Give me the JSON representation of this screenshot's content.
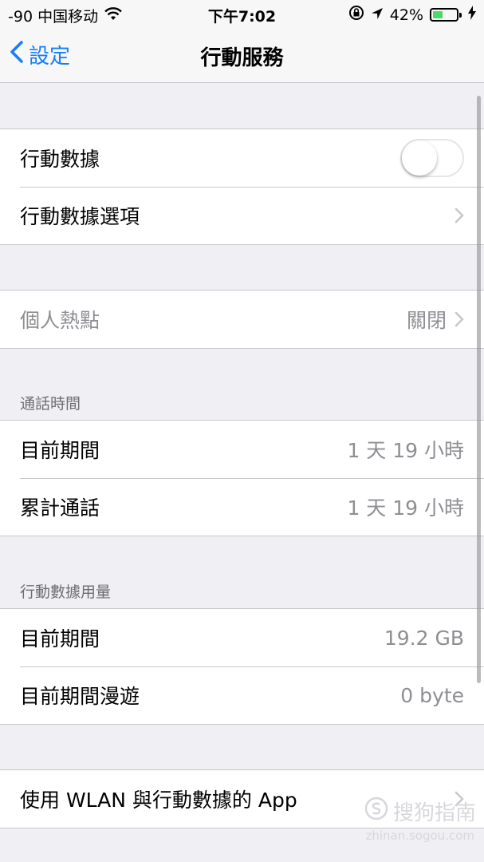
{
  "status_bar": {
    "carrier": "-90 中国移动",
    "time": "下午7:02",
    "battery_percent": "42%",
    "battery_level": 0.42,
    "icons": [
      "wifi-icon",
      "rotation-lock-icon",
      "location-arrow-icon",
      "battery-icon",
      "charging-bolt-icon"
    ]
  },
  "nav": {
    "back_label": "設定",
    "title": "行動服務"
  },
  "section1": {
    "rows": [
      {
        "label": "行動數據",
        "toggle_on": false
      },
      {
        "label": "行動數據選項"
      }
    ]
  },
  "section2": {
    "rows": [
      {
        "label": "個人熱點",
        "value": "關閉"
      }
    ]
  },
  "section3": {
    "header": "通話時間",
    "rows": [
      {
        "label": "目前期間",
        "value": "1 天 19 小時"
      },
      {
        "label": "累計通話",
        "value": "1 天 19 小時"
      }
    ]
  },
  "section4": {
    "header": "行動數據用量",
    "rows": [
      {
        "label": "目前期間",
        "value": "19.2 GB"
      },
      {
        "label": "目前期間漫遊",
        "value": "0 byte"
      }
    ]
  },
  "section5": {
    "rows": [
      {
        "label": "使用 WLAN 與行動數據的 App"
      }
    ]
  },
  "watermark": {
    "text": "搜狗指南",
    "url": "zhinan.sogou.com"
  },
  "colors": {
    "accent": "#147efb",
    "background": "#efeff4",
    "secondary_text": "#8e8e93",
    "separator": "#c8c7cc",
    "battery_fill": "#4cd964"
  }
}
